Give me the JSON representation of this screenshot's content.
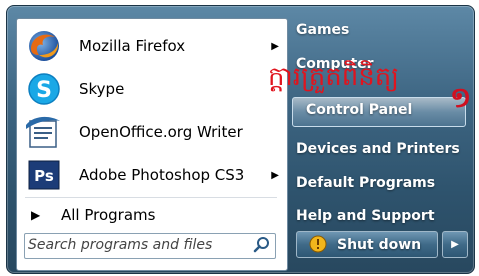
{
  "start_menu": {
    "programs": [
      {
        "label": "Mozilla Firefox",
        "icon": "firefox-icon",
        "has_submenu": true
      },
      {
        "label": "Skype",
        "icon": "skype-icon",
        "has_submenu": false
      },
      {
        "label": "OpenOffice.org Writer",
        "icon": "openoffice-writer-icon",
        "has_submenu": false
      },
      {
        "label": "Adobe Photoshop CS3",
        "icon": "photoshop-icon",
        "has_submenu": true
      }
    ],
    "all_programs_label": "All Programs",
    "search_placeholder": "Search programs and files",
    "right_items": [
      {
        "label": "Games"
      },
      {
        "label": "Computer"
      },
      {
        "label": "Control Panel"
      },
      {
        "label": "Devices and Printers"
      },
      {
        "label": "Default Programs"
      },
      {
        "label": "Help and Support"
      }
    ],
    "shutdown_label": "Shut down"
  },
  "annotation": {
    "text": "ក្តារត្រួតពិនិត្យ",
    "number": "១",
    "color": "#e0141e"
  },
  "colors": {
    "panel_dark": "#2e536d",
    "panel_light": "#5d88a6",
    "highlight": "#c8dceb"
  }
}
